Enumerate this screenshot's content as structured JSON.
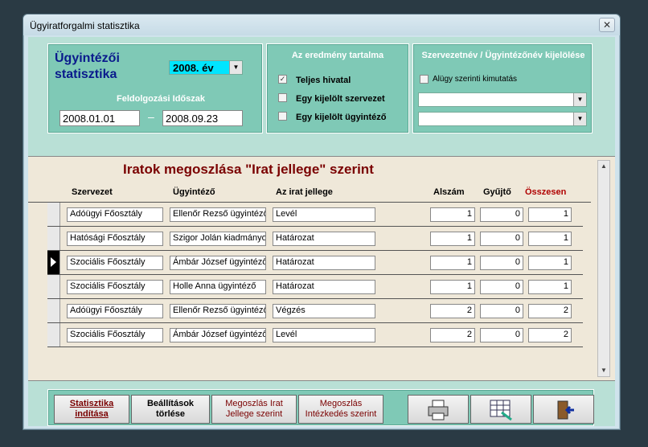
{
  "window": {
    "title": "Ügyiratforgalmi statisztika",
    "close_glyph": "✕"
  },
  "panel1": {
    "title": "Ügyintézői statisztika",
    "year_value": "2008. év",
    "period_label": "Feldolgozási Időszak",
    "date_from": "2008.01.01",
    "date_separator": "–",
    "date_to": "2008.09.23"
  },
  "panel2": {
    "title": "Az eredmény tartalma",
    "options": [
      {
        "label": "Teljes hivatal",
        "checked": true
      },
      {
        "label": "Egy kijelölt szervezet",
        "checked": false
      },
      {
        "label": "Egy kijelölt ügyintéző",
        "checked": false
      }
    ]
  },
  "panel3": {
    "title": "Szervezetnév / Ügyintézőnév kijelölése",
    "checkbox_label": "Alügy szerinti kimutatás",
    "combo1_value": "",
    "combo2_value": ""
  },
  "grid": {
    "title": "Iratok megoszlása \"Irat jellege\" szerint",
    "headers": {
      "szervezet": "Szervezet",
      "ugyintezo": "Ügyintéző",
      "jelleg": "Az irat jellege",
      "alszam": "Alszám",
      "gyujto": "Gyűjtő",
      "osszesen": "Összesen"
    },
    "rows": [
      {
        "szervezet": "Adóügyi Főosztály",
        "ugyintezo": "Ellenőr Rezső ügyintéző",
        "jelleg": "Levél",
        "alszam": "1",
        "gyujto": "0",
        "osszesen": "1"
      },
      {
        "szervezet": "Hatósági Főosztály",
        "ugyintezo": "Szigor Jolán kiadmányoz",
        "jelleg": "Határozat",
        "alszam": "1",
        "gyujto": "0",
        "osszesen": "1"
      },
      {
        "szervezet": "Szociális Főosztály",
        "ugyintezo": "Ámbár József ügyintéző",
        "jelleg": "Határozat",
        "alszam": "1",
        "gyujto": "0",
        "osszesen": "1"
      },
      {
        "szervezet": "Szociális Főosztály",
        "ugyintezo": "Holle Anna ügyintéző",
        "jelleg": "Határozat",
        "alszam": "1",
        "gyujto": "0",
        "osszesen": "1"
      },
      {
        "szervezet": "Adóügyi Főosztály",
        "ugyintezo": "Ellenőr Rezső ügyintéző",
        "jelleg": "Végzés",
        "alszam": "2",
        "gyujto": "0",
        "osszesen": "2"
      },
      {
        "szervezet": "Szociális Főosztály",
        "ugyintezo": "Ámbár József ügyintéző",
        "jelleg": "Levél",
        "alszam": "2",
        "gyujto": "0",
        "osszesen": "2"
      }
    ],
    "active_row": 2
  },
  "buttons": {
    "start_line1": "Statisztika",
    "start_line2": "indítása",
    "clear_line1": "Beállítások",
    "clear_line2": "törlése",
    "jelleg_line1": "Megoszlás Irat",
    "jelleg_line2": "Jellege szerint",
    "intezkedes_line1": "Megoszlás",
    "intezkedes_line2": "Intézkedés szerint"
  },
  "icons": {
    "print": "printer-icon",
    "export": "spreadsheet-export-icon",
    "exit": "exit-door-icon"
  },
  "colors": {
    "panel": "#7fc9b6",
    "accent_red": "#7a0000",
    "title_blue": "#0a1a8c",
    "year_highlight": "#00e5ff"
  }
}
